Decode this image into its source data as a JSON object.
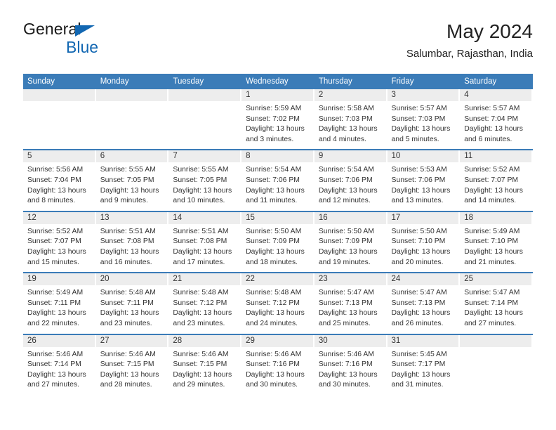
{
  "logo": {
    "word_one": "General",
    "word_two": "Blue",
    "triangle_color": "#1267b2",
    "blue_color": "#1267b2"
  },
  "header": {
    "title": "May 2024",
    "subtitle": "Salumbar, Rajasthan, India"
  },
  "theme": {
    "header_row_bg": "#3b7cb8",
    "daynum_band_bg": "#ededed",
    "row_rule": "#3b7cb8",
    "text": "#333333"
  },
  "weekday_headers": [
    "Sunday",
    "Monday",
    "Tuesday",
    "Wednesday",
    "Thursday",
    "Friday",
    "Saturday"
  ],
  "weeks": [
    [
      {
        "day": "",
        "sunrise": "",
        "sunset": "",
        "daylight_line1": "",
        "daylight_line2": "",
        "empty": true
      },
      {
        "day": "",
        "sunrise": "",
        "sunset": "",
        "daylight_line1": "",
        "daylight_line2": "",
        "empty": true
      },
      {
        "day": "",
        "sunrise": "",
        "sunset": "",
        "daylight_line1": "",
        "daylight_line2": "",
        "empty": true
      },
      {
        "day": "1",
        "sunrise": "Sunrise: 5:59 AM",
        "sunset": "Sunset: 7:02 PM",
        "daylight_line1": "Daylight: 13 hours",
        "daylight_line2": "and 3 minutes."
      },
      {
        "day": "2",
        "sunrise": "Sunrise: 5:58 AM",
        "sunset": "Sunset: 7:03 PM",
        "daylight_line1": "Daylight: 13 hours",
        "daylight_line2": "and 4 minutes."
      },
      {
        "day": "3",
        "sunrise": "Sunrise: 5:57 AM",
        "sunset": "Sunset: 7:03 PM",
        "daylight_line1": "Daylight: 13 hours",
        "daylight_line2": "and 5 minutes."
      },
      {
        "day": "4",
        "sunrise": "Sunrise: 5:57 AM",
        "sunset": "Sunset: 7:04 PM",
        "daylight_line1": "Daylight: 13 hours",
        "daylight_line2": "and 6 minutes."
      }
    ],
    [
      {
        "day": "5",
        "sunrise": "Sunrise: 5:56 AM",
        "sunset": "Sunset: 7:04 PM",
        "daylight_line1": "Daylight: 13 hours",
        "daylight_line2": "and 8 minutes."
      },
      {
        "day": "6",
        "sunrise": "Sunrise: 5:55 AM",
        "sunset": "Sunset: 7:05 PM",
        "daylight_line1": "Daylight: 13 hours",
        "daylight_line2": "and 9 minutes."
      },
      {
        "day": "7",
        "sunrise": "Sunrise: 5:55 AM",
        "sunset": "Sunset: 7:05 PM",
        "daylight_line1": "Daylight: 13 hours",
        "daylight_line2": "and 10 minutes."
      },
      {
        "day": "8",
        "sunrise": "Sunrise: 5:54 AM",
        "sunset": "Sunset: 7:06 PM",
        "daylight_line1": "Daylight: 13 hours",
        "daylight_line2": "and 11 minutes."
      },
      {
        "day": "9",
        "sunrise": "Sunrise: 5:54 AM",
        "sunset": "Sunset: 7:06 PM",
        "daylight_line1": "Daylight: 13 hours",
        "daylight_line2": "and 12 minutes."
      },
      {
        "day": "10",
        "sunrise": "Sunrise: 5:53 AM",
        "sunset": "Sunset: 7:06 PM",
        "daylight_line1": "Daylight: 13 hours",
        "daylight_line2": "and 13 minutes."
      },
      {
        "day": "11",
        "sunrise": "Sunrise: 5:52 AM",
        "sunset": "Sunset: 7:07 PM",
        "daylight_line1": "Daylight: 13 hours",
        "daylight_line2": "and 14 minutes."
      }
    ],
    [
      {
        "day": "12",
        "sunrise": "Sunrise: 5:52 AM",
        "sunset": "Sunset: 7:07 PM",
        "daylight_line1": "Daylight: 13 hours",
        "daylight_line2": "and 15 minutes."
      },
      {
        "day": "13",
        "sunrise": "Sunrise: 5:51 AM",
        "sunset": "Sunset: 7:08 PM",
        "daylight_line1": "Daylight: 13 hours",
        "daylight_line2": "and 16 minutes."
      },
      {
        "day": "14",
        "sunrise": "Sunrise: 5:51 AM",
        "sunset": "Sunset: 7:08 PM",
        "daylight_line1": "Daylight: 13 hours",
        "daylight_line2": "and 17 minutes."
      },
      {
        "day": "15",
        "sunrise": "Sunrise: 5:50 AM",
        "sunset": "Sunset: 7:09 PM",
        "daylight_line1": "Daylight: 13 hours",
        "daylight_line2": "and 18 minutes."
      },
      {
        "day": "16",
        "sunrise": "Sunrise: 5:50 AM",
        "sunset": "Sunset: 7:09 PM",
        "daylight_line1": "Daylight: 13 hours",
        "daylight_line2": "and 19 minutes."
      },
      {
        "day": "17",
        "sunrise": "Sunrise: 5:50 AM",
        "sunset": "Sunset: 7:10 PM",
        "daylight_line1": "Daylight: 13 hours",
        "daylight_line2": "and 20 minutes."
      },
      {
        "day": "18",
        "sunrise": "Sunrise: 5:49 AM",
        "sunset": "Sunset: 7:10 PM",
        "daylight_line1": "Daylight: 13 hours",
        "daylight_line2": "and 21 minutes."
      }
    ],
    [
      {
        "day": "19",
        "sunrise": "Sunrise: 5:49 AM",
        "sunset": "Sunset: 7:11 PM",
        "daylight_line1": "Daylight: 13 hours",
        "daylight_line2": "and 22 minutes."
      },
      {
        "day": "20",
        "sunrise": "Sunrise: 5:48 AM",
        "sunset": "Sunset: 7:11 PM",
        "daylight_line1": "Daylight: 13 hours",
        "daylight_line2": "and 23 minutes."
      },
      {
        "day": "21",
        "sunrise": "Sunrise: 5:48 AM",
        "sunset": "Sunset: 7:12 PM",
        "daylight_line1": "Daylight: 13 hours",
        "daylight_line2": "and 23 minutes."
      },
      {
        "day": "22",
        "sunrise": "Sunrise: 5:48 AM",
        "sunset": "Sunset: 7:12 PM",
        "daylight_line1": "Daylight: 13 hours",
        "daylight_line2": "and 24 minutes."
      },
      {
        "day": "23",
        "sunrise": "Sunrise: 5:47 AM",
        "sunset": "Sunset: 7:13 PM",
        "daylight_line1": "Daylight: 13 hours",
        "daylight_line2": "and 25 minutes."
      },
      {
        "day": "24",
        "sunrise": "Sunrise: 5:47 AM",
        "sunset": "Sunset: 7:13 PM",
        "daylight_line1": "Daylight: 13 hours",
        "daylight_line2": "and 26 minutes."
      },
      {
        "day": "25",
        "sunrise": "Sunrise: 5:47 AM",
        "sunset": "Sunset: 7:14 PM",
        "daylight_line1": "Daylight: 13 hours",
        "daylight_line2": "and 27 minutes."
      }
    ],
    [
      {
        "day": "26",
        "sunrise": "Sunrise: 5:46 AM",
        "sunset": "Sunset: 7:14 PM",
        "daylight_line1": "Daylight: 13 hours",
        "daylight_line2": "and 27 minutes."
      },
      {
        "day": "27",
        "sunrise": "Sunrise: 5:46 AM",
        "sunset": "Sunset: 7:15 PM",
        "daylight_line1": "Daylight: 13 hours",
        "daylight_line2": "and 28 minutes."
      },
      {
        "day": "28",
        "sunrise": "Sunrise: 5:46 AM",
        "sunset": "Sunset: 7:15 PM",
        "daylight_line1": "Daylight: 13 hours",
        "daylight_line2": "and 29 minutes."
      },
      {
        "day": "29",
        "sunrise": "Sunrise: 5:46 AM",
        "sunset": "Sunset: 7:16 PM",
        "daylight_line1": "Daylight: 13 hours",
        "daylight_line2": "and 30 minutes."
      },
      {
        "day": "30",
        "sunrise": "Sunrise: 5:46 AM",
        "sunset": "Sunset: 7:16 PM",
        "daylight_line1": "Daylight: 13 hours",
        "daylight_line2": "and 30 minutes."
      },
      {
        "day": "31",
        "sunrise": "Sunrise: 5:45 AM",
        "sunset": "Sunset: 7:17 PM",
        "daylight_line1": "Daylight: 13 hours",
        "daylight_line2": "and 31 minutes."
      },
      {
        "day": "",
        "sunrise": "",
        "sunset": "",
        "daylight_line1": "",
        "daylight_line2": "",
        "empty": true
      }
    ]
  ]
}
